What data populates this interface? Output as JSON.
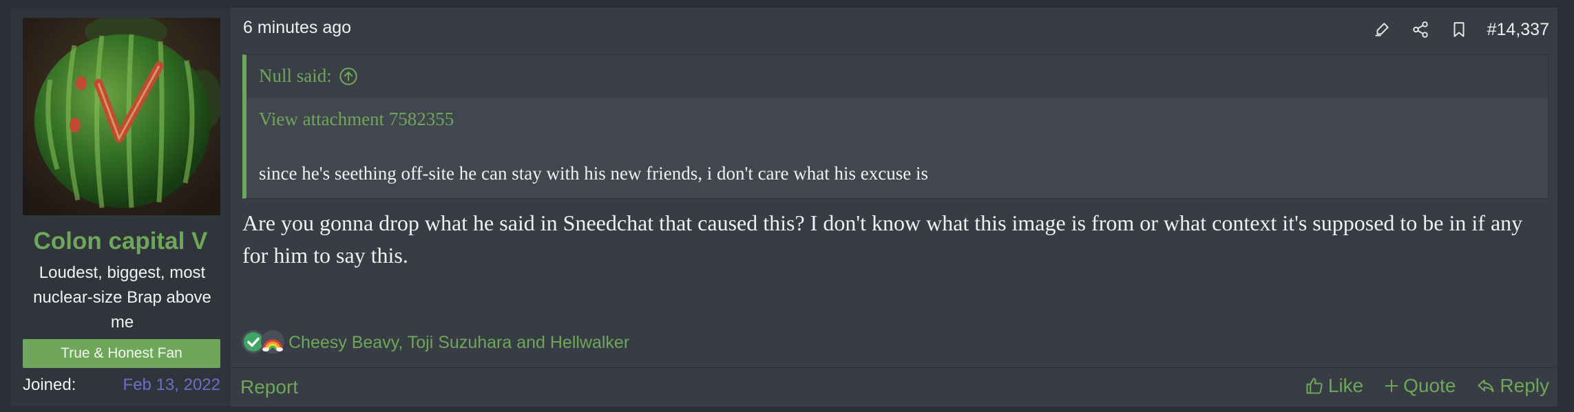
{
  "user": {
    "username": "Colon capital V",
    "title": "Loudest, biggest, most nuclear-size Brap above me",
    "banner": "True & Honest Fan",
    "joined_label": "Joined:",
    "joined_date": "Feb 13, 2022",
    "avatar_icon": "watermelon-avatar-icon"
  },
  "post": {
    "time": "6 minutes ago",
    "number": "#14,337",
    "quote": {
      "author": "Null said:",
      "attachment": "View attachment 7582355",
      "text": "since he's seething off-site he can stay with his new friends, i don't care what his excuse is"
    },
    "message": "Are you gonna drop what he said in Sneedchat that caused this? I don't know what this image is from or what context it's supposed to be in if any for him to say this.",
    "reactions": {
      "users": "Cheesy Beavy, Toji Suzuhara and Hellwalker",
      "icons": [
        "check-reaction-icon",
        "rainbow-reaction-icon"
      ]
    }
  },
  "footer": {
    "report": "Report",
    "like": "Like",
    "quote": "Quote",
    "reply": "Reply"
  },
  "colors": {
    "accent": "#6ea75a",
    "background": "#383c44",
    "panel": "#30343b",
    "joined_date": "#6a6fc9"
  }
}
